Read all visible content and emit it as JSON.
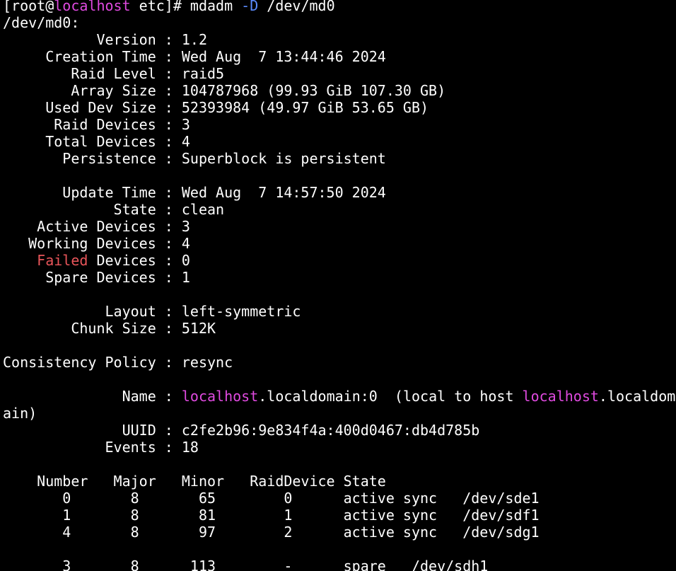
{
  "colors": {
    "background": "#000000",
    "text": "#ffffff",
    "hostname": "#e04ae0",
    "option": "#5b8cff",
    "failed": "#e8555a"
  },
  "terminal": {
    "lines": [
      [
        {
          "t": "[root@"
        },
        {
          "t": "localhost",
          "c": "hostname"
        },
        {
          "t": " etc]# mdadm "
        },
        {
          "t": "-D",
          "c": "option"
        },
        {
          "t": " /dev/md0"
        }
      ],
      [
        {
          "t": "/dev/md0:"
        }
      ],
      [
        {
          "t": "           Version : 1.2"
        }
      ],
      [
        {
          "t": "     Creation Time : Wed Aug  7 13:44:46 2024"
        }
      ],
      [
        {
          "t": "        Raid Level : raid5"
        }
      ],
      [
        {
          "t": "        Array Size : 104787968 (99.93 GiB 107.30 GB)"
        }
      ],
      [
        {
          "t": "     Used Dev Size : 52393984 (49.97 GiB 53.65 GB)"
        }
      ],
      [
        {
          "t": "      Raid Devices : 3"
        }
      ],
      [
        {
          "t": "     Total Devices : 4"
        }
      ],
      [
        {
          "t": "       Persistence : Superblock is persistent"
        }
      ],
      [],
      [
        {
          "t": "       Update Time : Wed Aug  7 14:57:50 2024"
        }
      ],
      [
        {
          "t": "             State : clean"
        }
      ],
      [
        {
          "t": "    Active Devices : 3"
        }
      ],
      [
        {
          "t": "   Working Devices : 4"
        }
      ],
      [
        {
          "t": "    "
        },
        {
          "t": "Failed",
          "c": "failed"
        },
        {
          "t": " Devices : 0"
        }
      ],
      [
        {
          "t": "     Spare Devices : 1"
        }
      ],
      [],
      [
        {
          "t": "            Layout : left-symmetric"
        }
      ],
      [
        {
          "t": "        Chunk Size : 512K"
        }
      ],
      [],
      [
        {
          "t": "Consistency Policy : resync"
        }
      ],
      [],
      [
        {
          "t": "              Name : "
        },
        {
          "t": "localhost",
          "c": "hostname"
        },
        {
          "t": ".localdomain:0  (local to host "
        },
        {
          "t": "localhost",
          "c": "hostname"
        },
        {
          "t": ".localdom"
        }
      ],
      [
        {
          "t": "ain)"
        }
      ],
      [
        {
          "t": "              UUID : c2fe2b96:9e834f4a:400d0467:db4d785b"
        }
      ],
      [
        {
          "t": "            Events : 18"
        }
      ],
      [],
      [
        {
          "t": "    Number   Major   Minor   RaidDevice State"
        }
      ],
      [
        {
          "t": "       0       8       65        0      active sync   /dev/sde1"
        }
      ],
      [
        {
          "t": "       1       8       81        1      active sync   /dev/sdf1"
        }
      ],
      [
        {
          "t": "       4       8       97        2      active sync   /dev/sdg1"
        }
      ],
      [],
      [
        {
          "t": "       3       8      113        -      spare   /dev/sdh1"
        }
      ]
    ]
  }
}
